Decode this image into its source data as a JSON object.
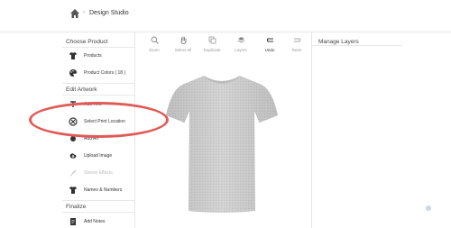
{
  "header": {
    "breadcrumb_separator": "›",
    "title": "Design Studio",
    "home_icon": "home-icon"
  },
  "sidebar": {
    "section_choose": "Choose Product",
    "products_label": "Products",
    "product_colors_label": "Product Colors ( 18 )",
    "section_edit": "Edit Artwork",
    "add_text_label": "Add Text",
    "select_print_location_label": "Select Print Location",
    "add_art_label": "Add Art",
    "upload_image_label": "Upload Image",
    "sleeve_effects_label": "Sleeve Effects",
    "names_numbers_label": "Names & Numbers",
    "section_finalize": "Finalize",
    "add_notes_label": "Add Notes"
  },
  "toolbar": {
    "zoom": "Zoom",
    "select_all": "Select All",
    "duplicate": "Duplicate",
    "layers": "Layers",
    "undo": "Undo",
    "redo": "Redo"
  },
  "right_panel": {
    "title": "Manage Layers"
  },
  "colors": {
    "highlight": "#e05a57",
    "shirt": "#cfcfcf"
  }
}
